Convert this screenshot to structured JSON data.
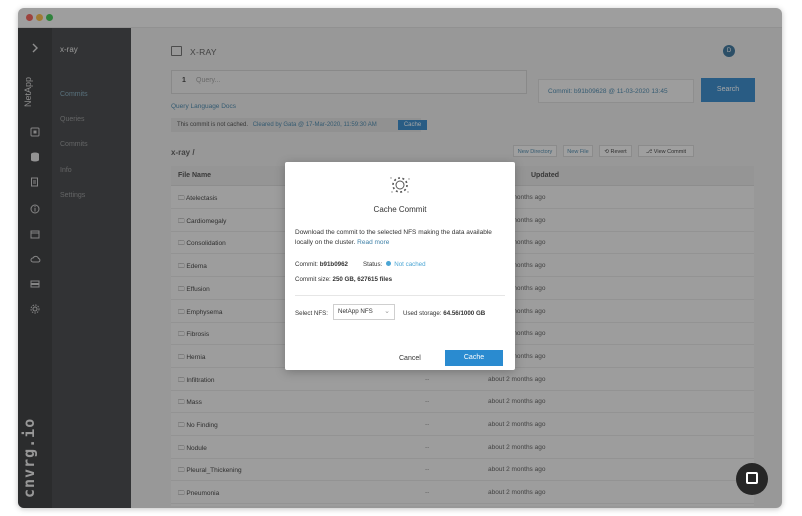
{
  "sidebar": {
    "netapp_label": "NetApp",
    "project": "x-ray",
    "items": [
      {
        "label": "Commits",
        "active": true
      },
      {
        "label": "Queries",
        "active": false
      },
      {
        "label": "Commits",
        "active": false
      },
      {
        "label": "Info",
        "active": false
      },
      {
        "label": "Settings",
        "active": false
      }
    ],
    "brand": "cnvrg.io"
  },
  "header": {
    "title": "X-RAY",
    "avatar_initial": "D"
  },
  "query": {
    "line_number": "1",
    "placeholder": "Query...",
    "commit_label": "Commit: b91b09628 @ 11-03-2020 13:45",
    "search_label": "Search",
    "docs_link": "Query Language Docs"
  },
  "cache_bar": {
    "text": "This commit is not cached.",
    "cleared": "Cleared by Gata @ 17-Mar-2020, 11:59:30 AM",
    "button": "Cache"
  },
  "toolbar": {
    "path": "x-ray /",
    "new_directory": "New Directory",
    "new_file": "New File",
    "revert": "Revert",
    "view_commit": "View Commit"
  },
  "table": {
    "headers": {
      "name": "File Name",
      "updated": "Updated"
    },
    "rows": [
      {
        "name": "Atelectasis",
        "size": "",
        "updated": "about 2 months ago"
      },
      {
        "name": "Cardiomegaly",
        "size": "",
        "updated": "about 2 months ago"
      },
      {
        "name": "Consolidation",
        "size": "",
        "updated": "about 2 months ago"
      },
      {
        "name": "Edema",
        "size": "",
        "updated": "about 2 months ago"
      },
      {
        "name": "Effusion",
        "size": "",
        "updated": "about 2 months ago"
      },
      {
        "name": "Emphysema",
        "size": "",
        "updated": "about 2 months ago"
      },
      {
        "name": "Fibrosis",
        "size": "",
        "updated": "about 2 months ago"
      },
      {
        "name": "Hernia",
        "size": "",
        "updated": "about 2 months ago"
      },
      {
        "name": "Infiltration",
        "size": "--",
        "updated": "about 2 months ago"
      },
      {
        "name": "Mass",
        "size": "--",
        "updated": "about 2 months ago"
      },
      {
        "name": "No Finding",
        "size": "--",
        "updated": "about 2 months ago"
      },
      {
        "name": "Nodule",
        "size": "--",
        "updated": "about 2 months ago"
      },
      {
        "name": "Pleural_Thickening",
        "size": "--",
        "updated": "about 2 months ago"
      },
      {
        "name": "Pneumonia",
        "size": "--",
        "updated": "about 2 months ago"
      }
    ]
  },
  "modal": {
    "title": "Cache Commit",
    "description": "Download the commit to the selected NFS making the data available locally on the cluster.",
    "read_more": "Read more",
    "commit_label": "Commit:",
    "commit_value": "b91b0962",
    "status_label": "Status:",
    "status_value": "Not cached",
    "size_label": "Commit size:",
    "size_value": "250 GB, 627615 files",
    "nfs_label": "Select NFS:",
    "nfs_value": "NetApp NFS",
    "storage_label": "Used storage:",
    "storage_value": "64.56/1000 GB",
    "cancel_label": "Cancel",
    "cache_label": "Cache"
  },
  "colors": {
    "accent": "#2a82c7",
    "link": "#3d7fa6",
    "sidebar_bg": "#3a3c3e",
    "rail_bg": "#2d2f31"
  }
}
